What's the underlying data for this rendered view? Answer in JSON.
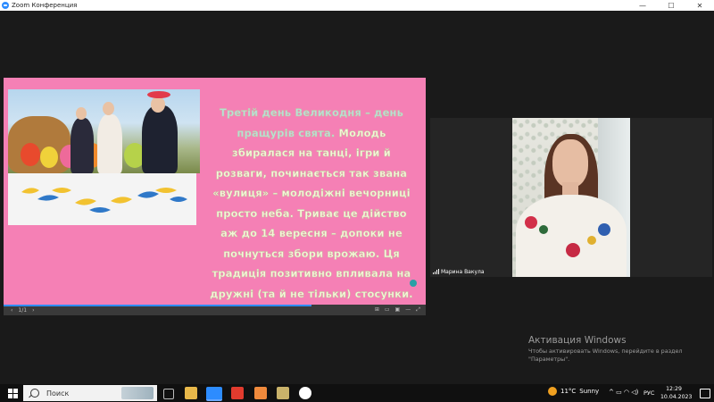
{
  "window": {
    "title": "Zoom Конференция",
    "controls": {
      "minimize": "—",
      "maximize": "☐",
      "close": "✕"
    }
  },
  "slide": {
    "text_lines": [
      {
        "text": "Третій день Великодня – день",
        "highlight": true
      },
      {
        "text": "пращурів свята. Молодь",
        "highlight": false,
        "lead": "пращурів свята."
      },
      {
        "text": "збиралася на танці, ігри й",
        "highlight": false
      },
      {
        "text": "розваги, починається так звана",
        "highlight": false
      },
      {
        "text": "«вулиця» – молодіжні вечорниці",
        "highlight": false
      },
      {
        "text": "просто неба. Триває це дійство",
        "highlight": false
      },
      {
        "text": "аж до 14 вересня – допоки не",
        "highlight": false
      },
      {
        "text": "почнуться збори врожаю. Ця",
        "highlight": false
      },
      {
        "text": "традиція позитивно впливала на",
        "highlight": false
      },
      {
        "text": "дружні (та й не тільки) стосунки.",
        "highlight": false
      }
    ],
    "toolbar": {
      "prev": "‹",
      "page": "1/1",
      "next": "›",
      "tools": [
        "⊞",
        "▭",
        "▣",
        "—",
        "⤢"
      ]
    },
    "progress_fraction": 0.73
  },
  "participant": {
    "name": "Марина Вакула"
  },
  "activation": {
    "title": "Активация Windows",
    "line1": "Чтобы активировать Windows, перейдите в раздел",
    "line2": "\"Параметры\"."
  },
  "taskbar": {
    "search_label": "Поиск",
    "weather_temp": "11°C",
    "weather_desc": "Sunny",
    "tray_icons": "^ ▭ ◠ ◁)",
    "language": "РУС",
    "time": "12:29",
    "date": "10.04.2023"
  },
  "colors": {
    "slide_bg": "#f580b5",
    "slide_text": "#f5f7d8",
    "zoom_blue": "#2d8cff"
  }
}
